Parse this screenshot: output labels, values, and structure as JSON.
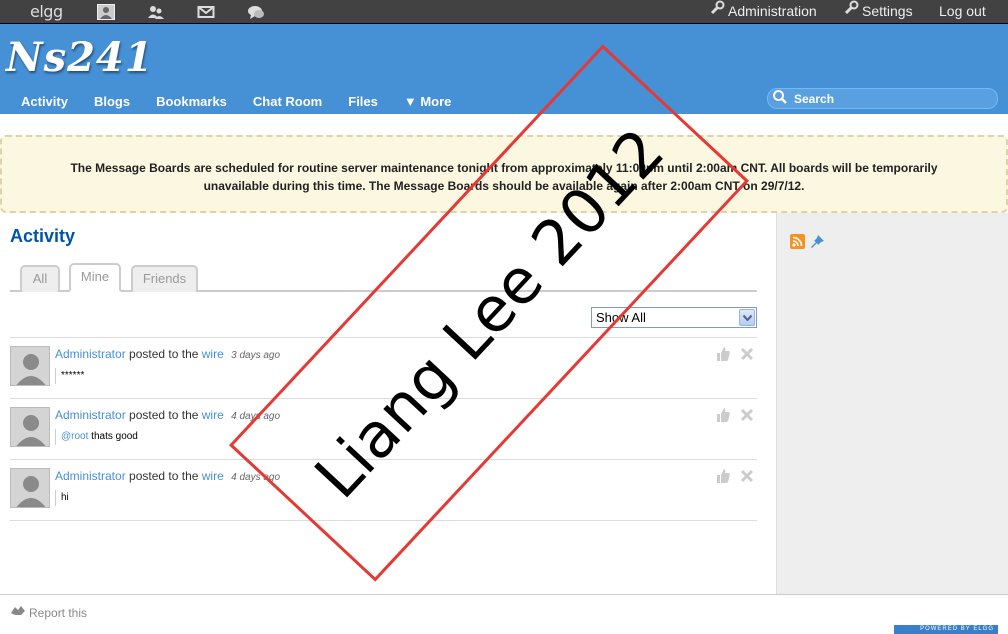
{
  "topbar": {
    "logo": "elgg",
    "admin_label": "Administration",
    "settings_label": "Settings",
    "logout_label": "Log out"
  },
  "header": {
    "site_title": "Ns241",
    "nav": [
      "Activity",
      "Blogs",
      "Bookmarks",
      "Chat Room",
      "Files",
      "▼ More"
    ],
    "search_placeholder": "Search"
  },
  "banner": {
    "message": "The Message Boards are scheduled for routine server maintenance tonight from approximately 11:00pm until 2:00am CNT. All boards will be temporarily unavailable during this time. The Message Boards should be available again after 2:00am CNT on 29/7/12."
  },
  "main": {
    "title": "Activity",
    "tabs": [
      "All",
      "Mine",
      "Friends"
    ],
    "active_tab": "Mine",
    "filter_value": "Show All",
    "items": [
      {
        "user": "Administrator",
        "verb": "posted to the",
        "target": "wire",
        "time": "3 days ago",
        "mention": "",
        "text": "******"
      },
      {
        "user": "Administrator",
        "verb": "posted to the",
        "target": "wire",
        "time": "4 days ago",
        "mention": "@root",
        "text": " thats good"
      },
      {
        "user": "Administrator",
        "verb": "posted to the",
        "target": "wire",
        "time": "4 days ago",
        "mention": "",
        "text": "hi"
      }
    ]
  },
  "footer": {
    "report_label": "Report this",
    "powered_label": "POWERED BY ELGG"
  },
  "watermark": {
    "text": "Liang Lee 2012"
  },
  "colors": {
    "topbar": "#424242",
    "header": "#4690d6",
    "link": "#4690d6",
    "title": "#0054a7",
    "watermark_border": "#e53935"
  }
}
